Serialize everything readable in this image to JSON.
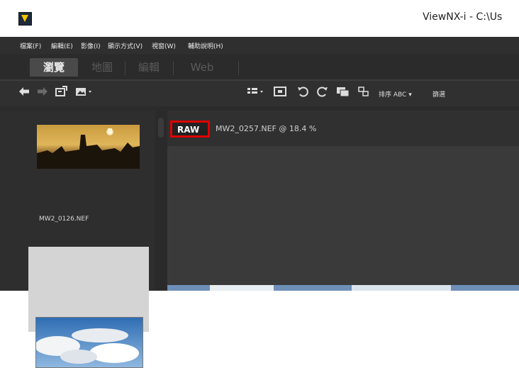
{
  "window": {
    "title": "ViewNX-i - C:\\Us"
  },
  "menu": {
    "items": [
      "檔案(F)",
      "編輯(E)",
      "影像(I)",
      "顯示方式(V)",
      "視窗(W)",
      "輔助說明(H)"
    ]
  },
  "tabs": {
    "items": [
      {
        "label": "瀏覽",
        "active": true
      },
      {
        "label": "地圖",
        "active": false
      },
      {
        "label": "編輯",
        "active": false
      },
      {
        "label": "Web",
        "active": false
      }
    ]
  },
  "toolbar": {
    "icons": [
      "back-arrow-icon",
      "forward-arrow-icon",
      "import-icon",
      "export-icon",
      "layout-icon",
      "fit-icon",
      "rotate-left-icon",
      "rotate-right-icon",
      "compare-icon",
      "group-icon"
    ],
    "sort_label": "排序 ABC",
    "filter_label": "篩選"
  },
  "thumbnails": [
    {
      "label": "MW2_0126.NEF"
    },
    {
      "label": ""
    }
  ],
  "viewer": {
    "badge": "RAW",
    "file_info": "MW2_0257.NEF @ 18.4 %"
  },
  "colors": {
    "highlight": "#e00000",
    "app_bg": "#2b2b2b"
  }
}
